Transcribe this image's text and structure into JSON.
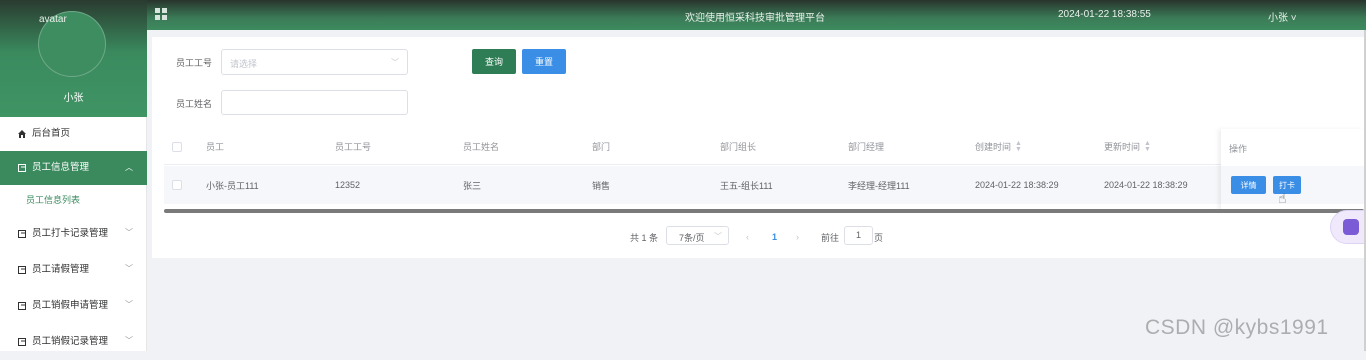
{
  "sidebar": {
    "avatar_alt": "avatar",
    "username": "小张",
    "items": [
      {
        "label": "后台首页",
        "icon": "home-icon"
      },
      {
        "label": "员工信息管理",
        "icon": "doc-icon",
        "active": true
      },
      {
        "label": "员工打卡记录管理",
        "icon": "doc-icon"
      },
      {
        "label": "员工请假管理",
        "icon": "doc-icon"
      },
      {
        "label": "员工销假申请管理",
        "icon": "doc-icon"
      },
      {
        "label": "员工销假记录管理",
        "icon": "doc-icon"
      }
    ],
    "subitem": "员工信息列表"
  },
  "topbar": {
    "title": "欢迎使用恒采科技审批管理平台",
    "datetime": "2024-01-22 18:38:55",
    "user": "小张"
  },
  "filters": {
    "emp_no_label": "员工工号",
    "emp_no_placeholder": "请选择",
    "emp_name_label": "员工姓名",
    "search_btn": "查询",
    "reset_btn": "重置"
  },
  "table": {
    "headers": [
      "员工",
      "员工工号",
      "员工姓名",
      "部门",
      "部门组长",
      "部门经理",
      "创建时间",
      "更新时间",
      "操作"
    ],
    "rows": [
      {
        "employee": "小张-员工111",
        "emp_no": "12352",
        "emp_name": "张三",
        "dept": "销售",
        "leader": "王五-组长111",
        "manager": "李经理-经理111",
        "created": "2024-01-22 18:38:29",
        "updated": "2024-01-22 18:38:29",
        "actions": [
          "详情",
          "打卡"
        ]
      }
    ]
  },
  "pagination": {
    "total": "共 1 条",
    "page_size": "7条/页",
    "current": "1",
    "goto_label": "前往",
    "goto_value": "1",
    "page_unit": "页"
  },
  "watermark": "CSDN @kybs1991",
  "colors": {
    "primary_green": "#2e7d54",
    "primary_blue": "#3a8ee6"
  }
}
